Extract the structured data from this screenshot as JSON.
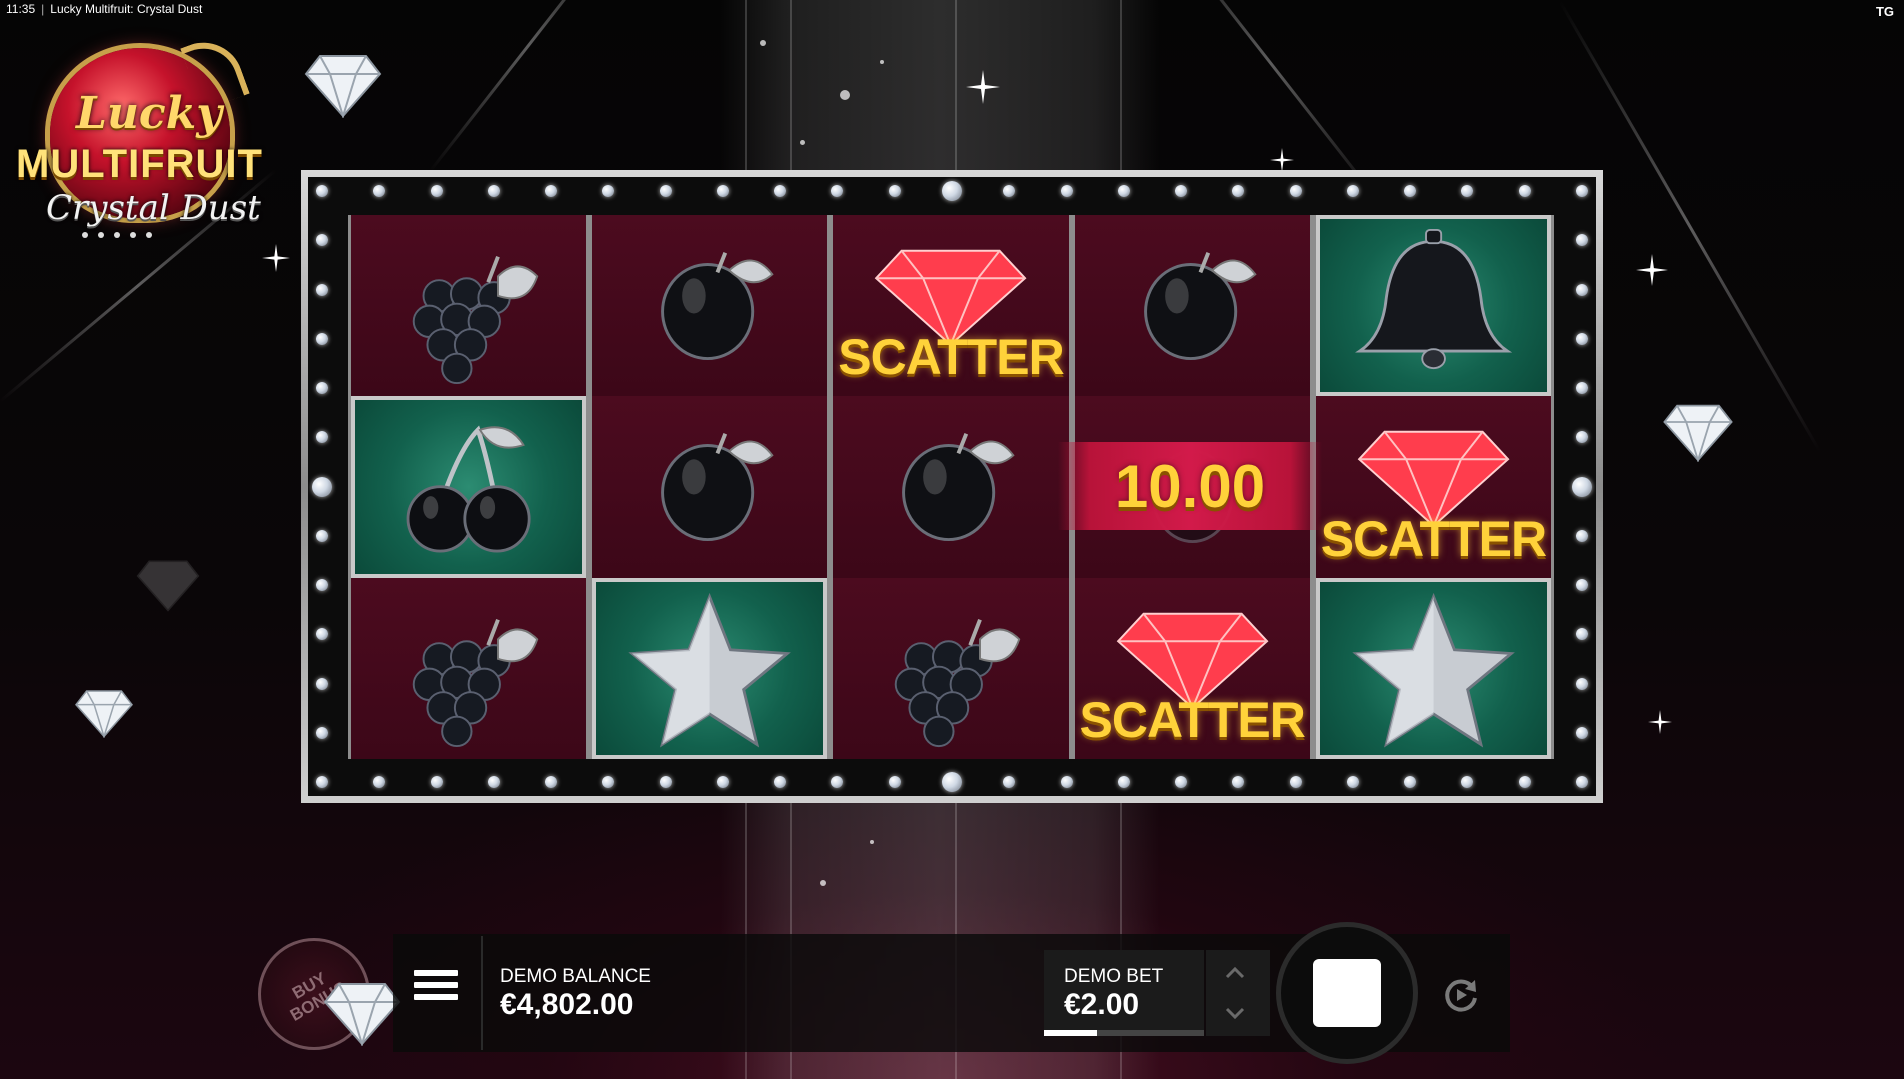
{
  "status_bar": {
    "time": "11:35",
    "separator": "|",
    "page_title": "Lucky Multifruit: Crystal Dust"
  },
  "corner_badge": "TG",
  "logo": {
    "word1": "Lucky",
    "word2": "MULTIFRUIT",
    "word3": "Crystal Dust"
  },
  "reels": {
    "columns": [
      [
        "grapes-icon",
        "cherries-icon",
        "grapes-icon"
      ],
      [
        "plum-icon",
        "plum-icon",
        "star-icon"
      ],
      [
        "scatter-diamond-icon",
        "plum-icon",
        "grapes-icon"
      ],
      [
        "plum-icon",
        "hidden-behind-win",
        "scatter-diamond-icon"
      ],
      [
        "bell-icon",
        "scatter-diamond-icon",
        "star-icon"
      ]
    ],
    "scatter_text": "SCATTER",
    "win_amount": "10.00"
  },
  "controls": {
    "buy_bonus_label": "BUY BONUS",
    "balance_label": "DEMO BALANCE",
    "balance_value": "€4,802.00",
    "bet_label": "DEMO BET",
    "bet_value": "€2.00",
    "bet_level_fraction": 0.33,
    "spin_state": "stop-icon",
    "autoplay_icon": "autoplay-icon",
    "menu_icon": "menu-icon"
  },
  "colors": {
    "reel_bg": "#4c0b1f",
    "highlight_cell": "#1a7a60",
    "scatter_gold": "#ffd23a",
    "win_banner": "#d21a4a"
  }
}
